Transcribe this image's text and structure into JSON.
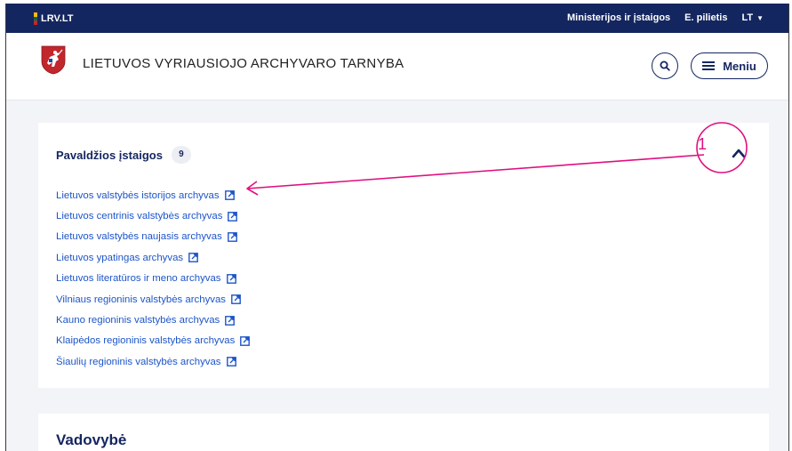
{
  "topbar": {
    "brand": "LRV.LT",
    "links": [
      "Ministerijos ir įstaigos",
      "E. pilietis"
    ],
    "language": "LT"
  },
  "header": {
    "title": "LIETUVOS VYRIAUSIOJO ARCHYVARO TARNYBA",
    "menu_label": "Meniu"
  },
  "section": {
    "title": "Pavaldžios įstaigos",
    "count": "9",
    "items": [
      "Lietuvos valstybės istorijos archyvas",
      "Lietuvos centrinis valstybės archyvas",
      "Lietuvos valstybės naujasis archyvas",
      "Lietuvos ypatingas archyvas",
      "Lietuvos literatūros ir meno archyvas",
      "Vilniaus regioninis valstybės archyvas",
      "Kauno regioninis valstybės archyvas",
      "Klaipėdos regioninis valstybės archyvas",
      "Šiaulių regioninis valstybės archyvas"
    ]
  },
  "section2": {
    "title": "Vadovybė"
  },
  "annotation": {
    "number": "1",
    "color": "#e0107f"
  },
  "colors": {
    "navy": "#14265f",
    "link": "#1d55c9",
    "background": "#f3f4f8"
  }
}
